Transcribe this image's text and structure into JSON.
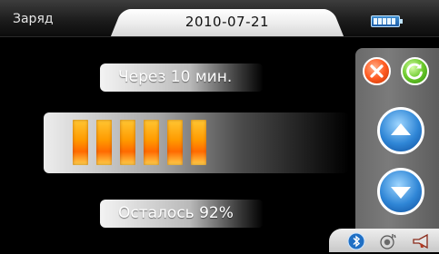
{
  "header": {
    "title": "Заряд",
    "date": "2010-07-21",
    "battery_icon": "battery-full-icon"
  },
  "main": {
    "time_label": "Через 10 мин.",
    "remaining_label": "Осталось  92%",
    "charge_fraction": 0.92,
    "charge_segments": 6
  },
  "right_panel": {
    "close_icon": "close-icon",
    "refresh_icon": "refresh-icon",
    "up_icon": "arrow-up-icon",
    "down_icon": "arrow-down-icon"
  },
  "tray": {
    "icons": [
      "bluetooth-icon",
      "speaker-icon",
      "horn-icon"
    ]
  },
  "colors": {
    "accent_blue": "#2f86d6",
    "segment_orange": "#ff9a00",
    "close_red": "#ff5b22",
    "refresh_green": "#6bc92b"
  }
}
